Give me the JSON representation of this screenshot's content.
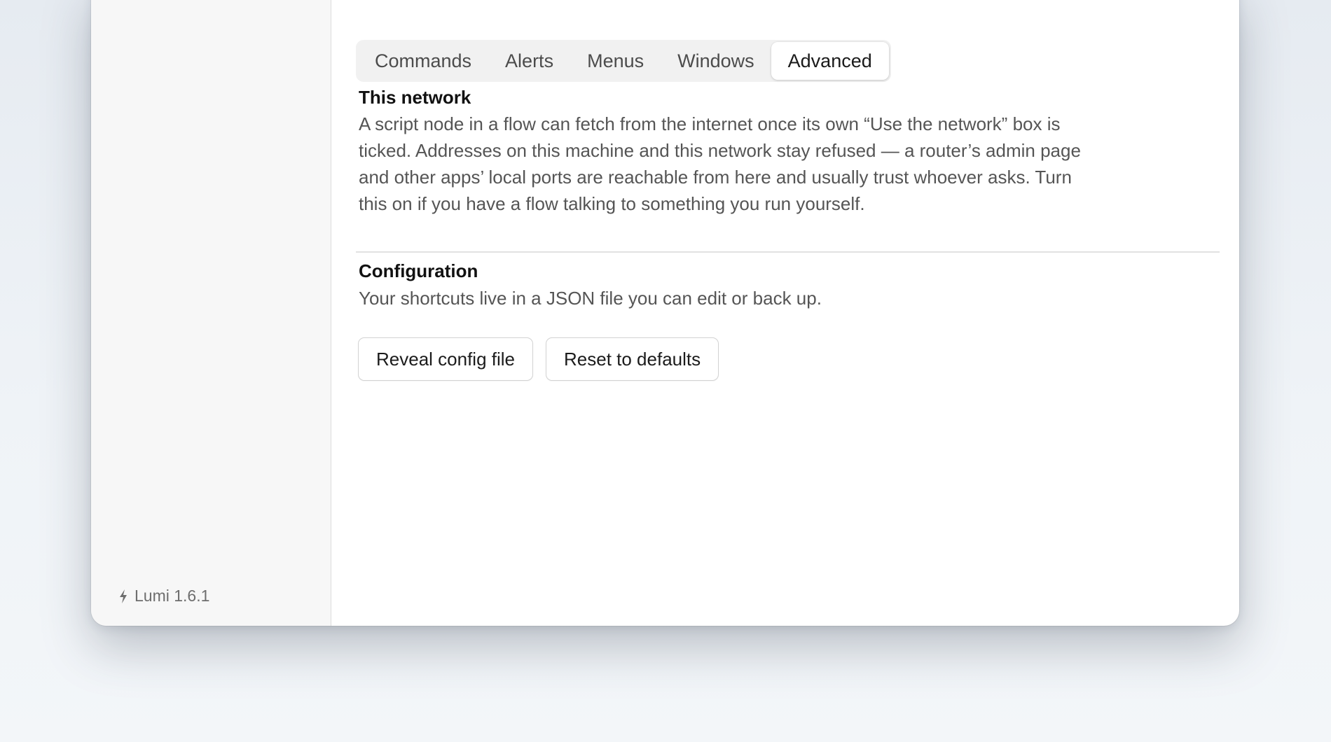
{
  "app": {
    "version_label": "Lumi 1.6.1",
    "version_icon": "bolt-icon"
  },
  "tabs": [
    {
      "label": "Commands",
      "active": false
    },
    {
      "label": "Alerts",
      "active": false
    },
    {
      "label": "Menus",
      "active": false
    },
    {
      "label": "Windows",
      "active": false
    },
    {
      "label": "Advanced",
      "active": true
    }
  ],
  "network": {
    "title": "This network",
    "description_lines": [
      "A script node in a flow can fetch from the internet once its own “Use the network” box is",
      "ticked. Addresses on this machine and this network stay refused — a router’s admin page",
      "and other apps’ local ports are reachable from here and usually trust whoever asks. Turn",
      "this on if you have a flow talking to something you run yourself."
    ],
    "toggle_on": false
  },
  "configuration": {
    "title": "Configuration",
    "description": "Your shortcuts live in a JSON file you can edit or back up.",
    "reveal_button": "Reveal config file",
    "reset_button": "Reset to defaults"
  }
}
